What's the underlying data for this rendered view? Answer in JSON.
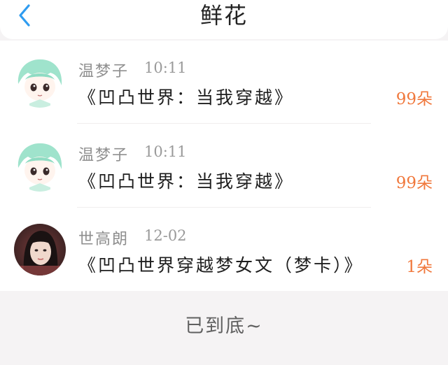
{
  "header": {
    "title": "鲜花",
    "back_icon": "chevron-left-icon",
    "accent_color": "#2f9cf0"
  },
  "items": [
    {
      "name": "温梦子",
      "time": "10:11",
      "book": "《凹凸世界：当我穿越》",
      "count": "99朵",
      "avatar": "anime-green-hair-avatar"
    },
    {
      "name": "温梦子",
      "time": "10:11",
      "book": "《凹凸世界：当我穿越》",
      "count": "99朵",
      "avatar": "anime-green-hair-avatar"
    },
    {
      "name": "世高朗",
      "time": "12-02",
      "book": "《凹凸世界穿越梦女文（梦卡）》",
      "count": "1朵",
      "avatar": "photo-avatar"
    }
  ],
  "footer": {
    "text": "已到底~"
  },
  "colors": {
    "count": "#f0783c",
    "background": "#f5f3f4"
  }
}
